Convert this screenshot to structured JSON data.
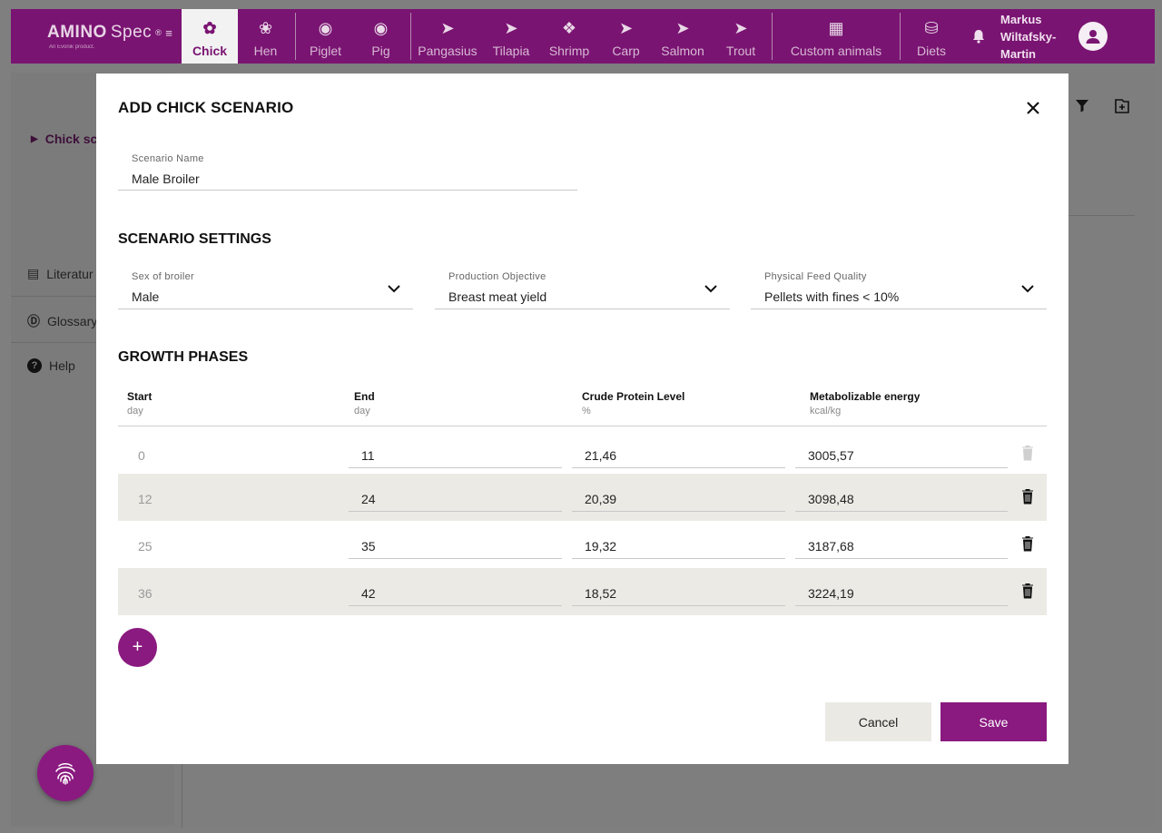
{
  "brand": {
    "name_bold": "AMINO",
    "name_light": "Spec",
    "reg": "®",
    "tagline": "An Evonik product."
  },
  "nav": {
    "items": [
      {
        "label": "Chick",
        "icon": "chick-icon",
        "active": true
      },
      {
        "label": "Hen",
        "icon": "hen-icon"
      },
      {
        "label": "Piglet",
        "icon": "piglet-icon"
      },
      {
        "label": "Pig",
        "icon": "pig-icon"
      },
      {
        "label": "Pangasius",
        "icon": "fish-icon"
      },
      {
        "label": "Tilapia",
        "icon": "fish-icon"
      },
      {
        "label": "Shrimp",
        "icon": "shrimp-icon"
      },
      {
        "label": "Carp",
        "icon": "fish-icon"
      },
      {
        "label": "Salmon",
        "icon": "fish-icon"
      },
      {
        "label": "Trout",
        "icon": "fish-icon"
      }
    ],
    "custom_label": "Custom animals",
    "diets_label": "Diets",
    "user": {
      "line1": "Markus",
      "line2": "Wiltafsky-",
      "line3": "Martin"
    }
  },
  "background": {
    "scenario_item": "Chick sc",
    "literature": "Literatur",
    "glossary": "Glossary",
    "help": "Help"
  },
  "modal": {
    "title": "ADD CHICK SCENARIO",
    "scenario_name": {
      "label": "Scenario Name",
      "value": "Male Broiler"
    },
    "settings_title": "SCENARIO SETTINGS",
    "sex": {
      "label": "Sex of broiler",
      "value": "Male"
    },
    "objective": {
      "label": "Production Objective",
      "value": "Breast meat yield"
    },
    "feed_quality": {
      "label": "Physical Feed Quality",
      "value": "Pellets with fines < 10%"
    },
    "growth_title": "GROWTH PHASES",
    "columns": [
      {
        "title": "Start",
        "unit": "day"
      },
      {
        "title": "End",
        "unit": "day"
      },
      {
        "title": "Crude Protein Level",
        "unit": "%"
      },
      {
        "title": "Metabolizable energy",
        "unit": "kcal/kg"
      }
    ],
    "rows": [
      {
        "start": "0",
        "end": "11",
        "protein": "21,46",
        "energy": "3005,57",
        "deletable": false
      },
      {
        "start": "12",
        "end": "24",
        "protein": "20,39",
        "energy": "3098,48",
        "deletable": true
      },
      {
        "start": "25",
        "end": "35",
        "protein": "19,32",
        "energy": "3187,68",
        "deletable": true
      },
      {
        "start": "36",
        "end": "42",
        "protein": "18,52",
        "energy": "3224,19",
        "deletable": true
      }
    ],
    "add_label": "+",
    "cancel_label": "Cancel",
    "save_label": "Save"
  },
  "colors": {
    "brand": "#7a1472",
    "accent": "#8a1a80",
    "row_shade": "#eceae5"
  }
}
